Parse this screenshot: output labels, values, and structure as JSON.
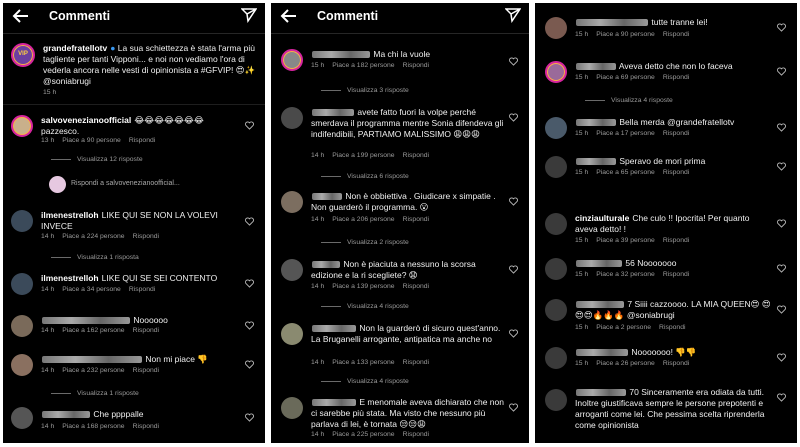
{
  "header": {
    "title": "Commenti"
  },
  "panel1": {
    "caption": {
      "user": "grandefratellotv",
      "text": "La sua schiettezza è stata l'arma più tagliente per tanti Vipponi... e noi non vediamo l'ora di vederla ancora nelle vesti di opinionista a #GFVIP! 😍✨ @soniabrugi",
      "time": "15 h"
    },
    "comments": [
      {
        "user": "salvovenezianoofficial",
        "text": "😂😂😂😂😂😂😂 pazzesco.",
        "time": "13 h",
        "likes": "Piace a 90 persone",
        "reply": "Rispondi",
        "view": "Visualizza 12 risposte"
      },
      {
        "user": "ilmenestrelloh",
        "text": "LIKE QUI SE NON LA VOLEVI INVECE",
        "time": "14 h",
        "likes": "Piace a 224 persone",
        "reply": "Rispondi",
        "view": "Visualizza 1 risposta"
      },
      {
        "user": "ilmenestrelloh",
        "text": "LIKE QUI SE SEI CONTENTO",
        "time": "14 h",
        "likes": "Piace a 34 persone",
        "reply": "Rispondi",
        "view": ""
      },
      {
        "user": "",
        "text": "Noooooo",
        "time": "14 h",
        "likes": "Piace a 162 persone",
        "reply": "Rispondi",
        "view": ""
      },
      {
        "user": "",
        "text": "Non mi piace 👎",
        "time": "14 h",
        "likes": "Piace a 232 persone",
        "reply": "Rispondi",
        "view": "Visualizza 1 risposte"
      },
      {
        "user": "",
        "text": "Che ppppalle",
        "time": "14 h",
        "likes": "Piace a 168 persone",
        "reply": "Rispondi",
        "view": ""
      }
    ],
    "reply_to": "Rispondi a salvovenezianoofficial..."
  },
  "panel2": {
    "comments": [
      {
        "text": "Ma chi la vuole",
        "time": "15 h",
        "likes": "Piace a 182 persone",
        "reply": "Rispondi",
        "view": "Visualizza 3 risposte"
      },
      {
        "text": "avete fatto fuori la volpe perché smerdava il programma mentre Sonia difendeva gli indifendibili, PARTIAMO MALISSIMO 😩😩😩",
        "time": "14 h",
        "likes": "Piace a 199 persone",
        "reply": "Rispondi",
        "view": "Visualizza 6 risposte"
      },
      {
        "text": "Non è obbiettiva . Giudicare x simpatie . Non guarderò il programma. 😮",
        "time": "14 h",
        "likes": "Piace a 206 persone",
        "reply": "Rispondi",
        "view": "Visualizza 2 risposte"
      },
      {
        "text": "Non è piaciuta a nessuno la scorsa edizione e la ri scegliete? 😧",
        "time": "14 h",
        "likes": "Piace a 139 persone",
        "reply": "Rispondi",
        "view": "Visualizza 4 risposte"
      },
      {
        "text": "Non la guarderò di sicuro quest'anno. La Bruganelli arrogante, antipatica ma anche no",
        "time": "14 h",
        "likes": "Piace a 133 persone",
        "reply": "Rispondi",
        "view": "Visualizza 4 risposte"
      },
      {
        "text": "E menomale aveva dichiarato che non ci sarebbe più stata. Ma visto che nessuno più parlava di lei, è tornata 😒😒😩",
        "time": "14 h",
        "likes": "Piace a 225 persone",
        "reply": "Rispondi",
        "view": ""
      }
    ]
  },
  "panel3": {
    "comments": [
      {
        "user": "",
        "text": "tutte tranne lei!",
        "time": "15 h",
        "likes": "Piace a 90 persone",
        "reply": "Rispondi",
        "view": ""
      },
      {
        "user": "",
        "text": "Aveva detto che non lo faceva",
        "time": "15 h",
        "likes": "Piace a 69 persone",
        "reply": "Rispondi",
        "view": "Visualizza 4 risposte"
      },
      {
        "user": "",
        "text": "Bella merda @grandefratellotv",
        "time": "15 h",
        "likes": "Piace a 17 persone",
        "reply": "Rispondi",
        "view": ""
      },
      {
        "user": "",
        "text": "Speravo de mori prima",
        "time": "15 h",
        "likes": "Piace a 65 persone",
        "reply": "Rispondi",
        "view": ""
      },
      {
        "user": "cinziaulturale",
        "text": "Che culo !! Ipocrita! Per quanto aveva detto! !",
        "time": "15 h",
        "likes": "Piace a 39 persone",
        "reply": "Rispondi",
        "view": ""
      },
      {
        "user": "",
        "text": "56 Nooooooo",
        "time": "15 h",
        "likes": "Piace a 32 persone",
        "reply": "Rispondi",
        "view": ""
      },
      {
        "user": "",
        "text": "7 Siiii cazzoooo. LA MIA QUEEN😍 😍😍😍🔥🔥🔥 @soniabrugi",
        "time": "15 h",
        "likes": "Piace a 2 persone",
        "reply": "Rispondi",
        "view": ""
      },
      {
        "user": "",
        "text": "Nooooooo! 👎👎",
        "time": "15 h",
        "likes": "Piace a 26 persone",
        "reply": "Rispondi",
        "view": ""
      },
      {
        "user": "",
        "text": "70 Sinceramente era odiata da tutti. Inoltre giustificava sempre le persone prepotenti e arroganti come lei. Che pessima scelta riprenderla come opinionista",
        "time": "15 h",
        "likes": "",
        "reply": "",
        "view": ""
      }
    ]
  }
}
